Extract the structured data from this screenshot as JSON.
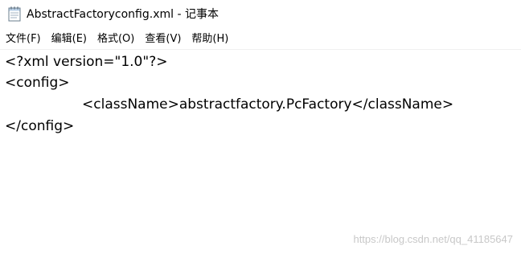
{
  "window": {
    "title": "AbstractFactoryconfig.xml - 记事本",
    "icon": "notepad-icon"
  },
  "menu": {
    "items": [
      {
        "label": "文件(F)"
      },
      {
        "label": "编辑(E)"
      },
      {
        "label": "格式(O)"
      },
      {
        "label": "查看(V)"
      },
      {
        "label": "帮助(H)"
      }
    ]
  },
  "editor": {
    "lines": [
      "<?xml version=\"1.0\"?>",
      "<config>",
      "<className>abstractfactory.PcFactory</className>",
      "</config>"
    ]
  },
  "watermark": "https://blog.csdn.net/qq_41185647"
}
